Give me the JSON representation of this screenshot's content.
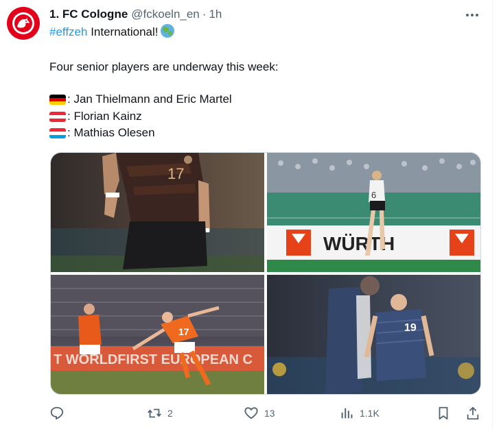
{
  "author": {
    "name": "1. FC Cologne",
    "handle": "@fckoeln_en",
    "separator": "·",
    "time": "1h"
  },
  "post": {
    "hashtag": "#effzeh",
    "headline_rest": " International!",
    "intro": "Four senior players are underway this week:",
    "lines": [
      {
        "flag": "germany-flag-icon",
        "text": ": Jan Thielmann and Eric Martel",
        "colors": [
          "#000000",
          "#dd0000",
          "#ffce00"
        ]
      },
      {
        "flag": "austria-flag-icon",
        "text": ": Florian Kainz",
        "colors": [
          "#ed2939",
          "#ffffff",
          "#ed2939"
        ]
      },
      {
        "flag": "luxembourg-flag-icon",
        "text": ": Mathias Olesen",
        "colors": [
          "#ed2939",
          "#ffffff",
          "#00a1de"
        ]
      }
    ]
  },
  "media": {
    "photos": [
      {
        "name": "photo-germany-player-17",
        "jersey": "17"
      },
      {
        "name": "photo-germany-player-6",
        "jersey": "6",
        "board_text": "WÜRTH"
      },
      {
        "name": "photo-austria-player-17",
        "jersey": "17",
        "board_text": "T WORLDFIRST   EUROPEAN C"
      },
      {
        "name": "photo-luxembourg-player-19",
        "jersey": "19"
      }
    ]
  },
  "actions": {
    "reply": {
      "icon": "reply-icon",
      "count": ""
    },
    "repost": {
      "icon": "repost-icon",
      "count": "2"
    },
    "like": {
      "icon": "like-icon",
      "count": "13"
    },
    "views": {
      "icon": "views-icon",
      "count": "1.1K"
    },
    "bookmark": {
      "icon": "bookmark-icon"
    },
    "share": {
      "icon": "share-icon"
    }
  },
  "colors": {
    "accent": "#1d9bf0",
    "secondary_text": "#536471",
    "brand_red": "#e2001a"
  }
}
